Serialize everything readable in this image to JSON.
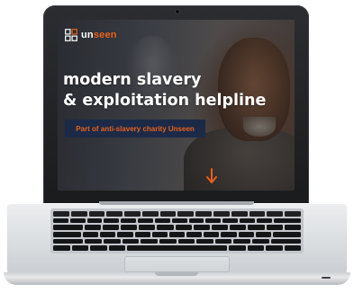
{
  "screen": {
    "logo": {
      "prefix": "un",
      "accent": "seen",
      "icon": "grid-squares-logo-icon"
    },
    "headline": {
      "line1": "modern slavery",
      "line2": "& exploitation helpline"
    },
    "cta_label": "Part of anti-slavery charity Unseen",
    "scroll_icon": "arrow-down-icon"
  },
  "colors": {
    "accent": "#e8601c",
    "cta_background": "#1c2a48",
    "text": "#ffffff"
  }
}
